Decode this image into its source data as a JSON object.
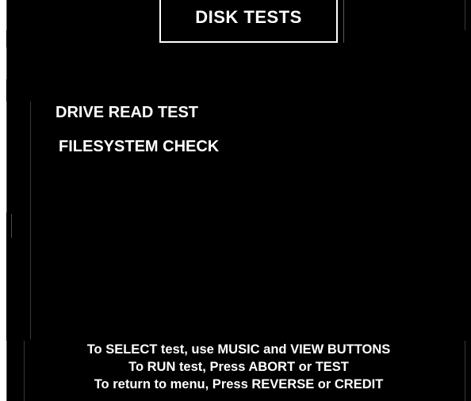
{
  "screen": {
    "title": "DISK TESTS",
    "background_color": "#000000",
    "text_color": "#ffffff"
  },
  "menu": {
    "items": [
      {
        "label": "DRIVE READ TEST"
      },
      {
        "label": "FILESYSTEM CHECK"
      }
    ]
  },
  "instructions": {
    "line_select": "To SELECT test, use MUSIC and VIEW BUTTONS",
    "line_run": "To RUN test, Press ABORT or TEST",
    "line_return": "To return to menu, Press REVERSE or CREDIT"
  }
}
